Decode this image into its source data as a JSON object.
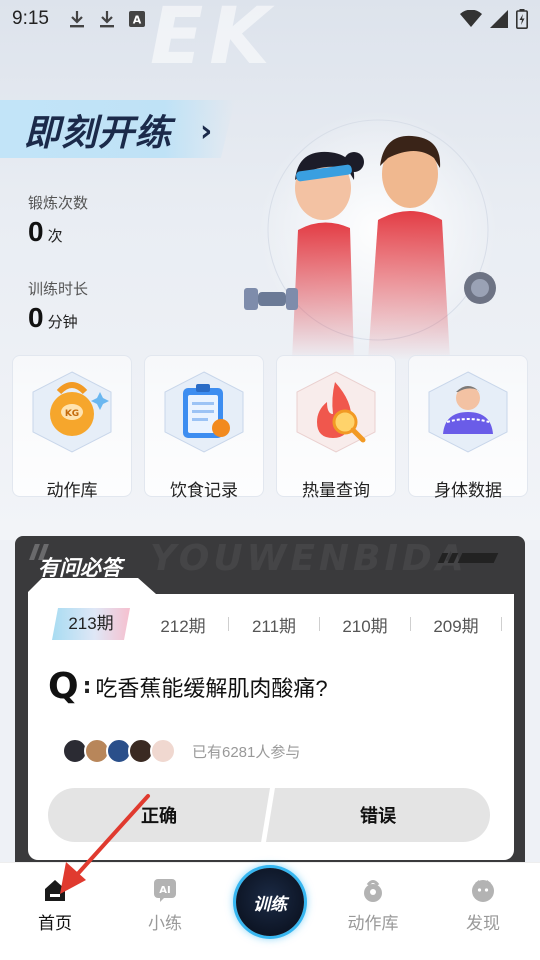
{
  "status_bar": {
    "time": "9:15",
    "left_icons": [
      "download-icon",
      "download-icon",
      "keyboard-a-icon"
    ],
    "right_icons": [
      "wifi-icon",
      "signal-icon",
      "battery-icon"
    ]
  },
  "hero": {
    "watermark": "EK",
    "start_title": "即刻开练",
    "arrow": "›",
    "stats": [
      {
        "label": "锻炼次数",
        "value": "0",
        "unit": "次"
      },
      {
        "label": "训练时长",
        "value": "0",
        "unit": "分钟"
      }
    ]
  },
  "tiles": [
    {
      "label": "动作库",
      "icon": "kettlebell-icon"
    },
    {
      "label": "饮食记录",
      "icon": "clipboard-icon"
    },
    {
      "label": "热量查询",
      "icon": "flame-search-icon"
    },
    {
      "label": "身体数据",
      "icon": "body-measure-icon"
    }
  ],
  "qa": {
    "title": "有问必答",
    "watermark": "YOUWENBIDA",
    "issues": [
      "213期",
      "212期",
      "211期",
      "210期",
      "209期"
    ],
    "active_issue": "213期",
    "q_mark": "Q",
    "question": "吃香蕉能缓解肌肉酸痛?",
    "participants": "已有6281人参与",
    "answers": {
      "correct": "正确",
      "wrong": "错误"
    }
  },
  "bottom_nav": {
    "items": [
      {
        "label": "首页",
        "icon": "home-icon",
        "active": true
      },
      {
        "label": "小练",
        "icon": "ai-icon",
        "active": false
      },
      {
        "label": "动作库",
        "icon": "kettlebell-icon",
        "active": false
      },
      {
        "label": "发现",
        "icon": "discover-icon",
        "active": false
      }
    ],
    "center_label": "训练"
  },
  "colors": {
    "accent_blue": "#36b6f0",
    "dark_card": "#3a3a3c",
    "annotation_red": "#e03a2f"
  }
}
